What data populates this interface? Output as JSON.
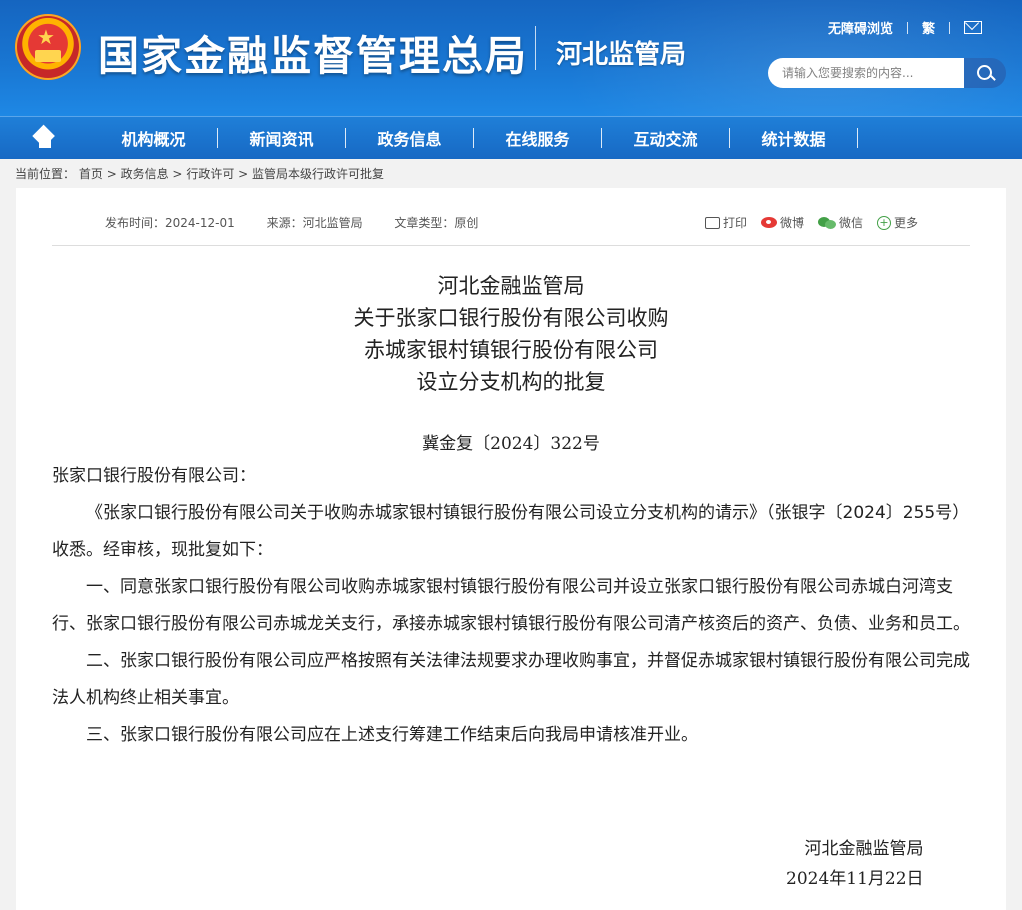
{
  "header": {
    "org_name": "国家金融监督管理总局",
    "sub_org": "河北监管局",
    "links": [
      "无障碍浏览",
      "繁"
    ],
    "search_placeholder": "请输入您要搜索的内容..."
  },
  "nav": {
    "items": [
      "机构概况",
      "新闻资讯",
      "政务信息",
      "在线服务",
      "互动交流",
      "统计数据"
    ]
  },
  "breadcrumb": {
    "label": "当前位置：",
    "path": [
      "首页",
      "政务信息",
      "行政许可",
      "监管局本级行政许可批复"
    ],
    "separator": ">"
  },
  "article": {
    "meta": {
      "publish_time": "发布时间：2024-12-01",
      "source": "来源：河北监管局",
      "doc_type": "文章类型：原创"
    },
    "share": {
      "print": "打印",
      "weibo": "微博",
      "wechat": "微信",
      "more": "更多"
    },
    "title_lines": [
      "河北金融监管局",
      "关于张家口银行股份有限公司收购",
      "赤城家银村镇银行股份有限公司",
      "设立分支机构的批复"
    ],
    "doc_number": "冀金复〔2024〕322号",
    "salutation": "张家口银行股份有限公司：",
    "paragraphs": [
      "《张家口银行股份有限公司关于收购赤城家银村镇银行股份有限公司设立分支机构的请示》（张银字〔2024〕255号）收悉。经审核，现批复如下：",
      "一、同意张家口银行股份有限公司收购赤城家银村镇银行股份有限公司并设立张家口银行股份有限公司赤城白河湾支行、张家口银行股份有限公司赤城龙关支行，承接赤城家银村镇银行股份有限公司清产核资后的资产、负债、业务和员工。",
      "二、张家口银行股份有限公司应严格按照有关法律法规要求办理收购事宜，并督促赤城家银村镇银行股份有限公司完成法人机构终止相关事宜。",
      "三、张家口银行股份有限公司应在上述支行筹建工作结束后向我局申请核准开业。"
    ],
    "signature": "河北金融监管局",
    "date": "2024年11月22日"
  }
}
